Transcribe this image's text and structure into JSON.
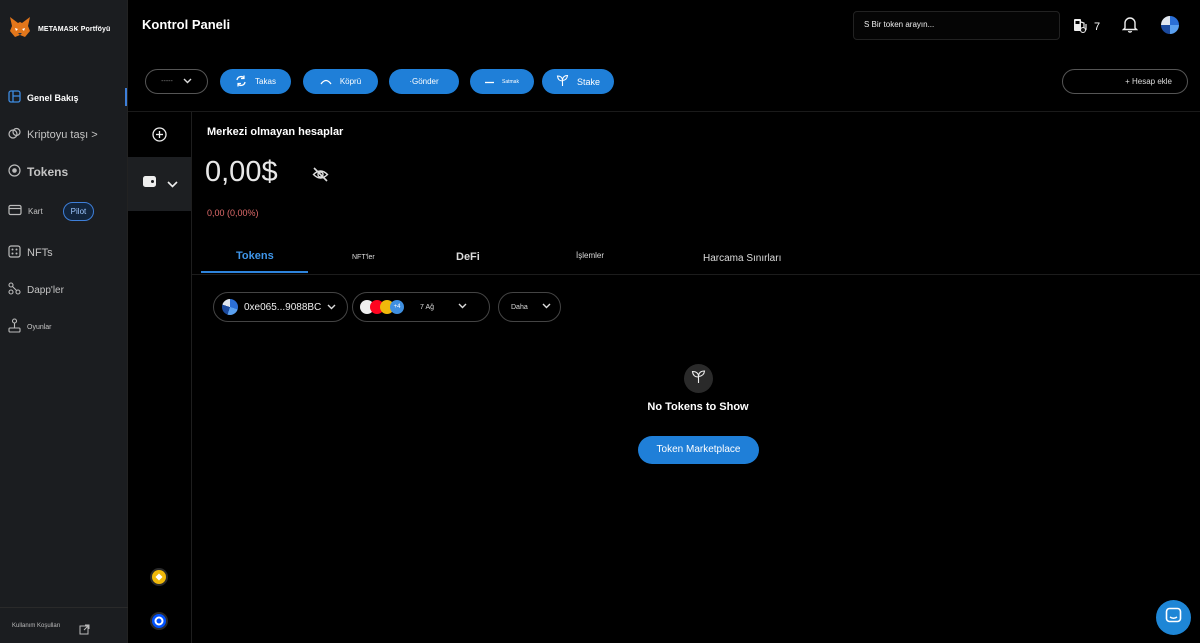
{
  "brand": {
    "name": "METAMASK Portföyü",
    "logo_icon": "fox-logo-icon"
  },
  "sidebar": {
    "items": [
      {
        "label": "Genel Bakış",
        "icon": "dashboard-icon"
      },
      {
        "label": "Kriptoyu taşı >",
        "icon": "move-icon"
      },
      {
        "label": "Tokens",
        "icon": "token-icon"
      },
      {
        "label": "Kart",
        "icon": "card-icon",
        "badge": "Pilot"
      },
      {
        "label": "NFTs",
        "icon": "grid-icon"
      },
      {
        "label": "Dapp'ler",
        "icon": "dapp-icon"
      },
      {
        "label": "Oyunlar",
        "icon": "joystick-icon"
      }
    ],
    "footer": {
      "label": "Kullanım Koşulları",
      "icon": "external-link-icon"
    }
  },
  "header": {
    "title": "Kontrol Paneli",
    "search_text": "S Bir token arayın...",
    "notifications_count": "7"
  },
  "toolbar": {
    "account_selector": "-----",
    "swap_label": "Takas",
    "bridge_label": "Köprü",
    "send_label": "·Gönder",
    "sell_label": "Satmak",
    "stake_label": "Stake",
    "add_account_label": "+ Hesap ekle"
  },
  "account": {
    "title": "Merkezi olmayan hesaplar",
    "balance": "0,00$",
    "change": "0,00 (0,00%)"
  },
  "tabs": [
    {
      "label": "Tokens",
      "active": true
    },
    {
      "label": "NFT'ler"
    },
    {
      "label": "DeFi"
    },
    {
      "label": "İşlemler"
    },
    {
      "label": "Harcama Sınırları"
    }
  ],
  "filters": {
    "address": "0xe065...9088BC",
    "networks": "7 Ağ",
    "networks_extra": "+4",
    "more": "Daha"
  },
  "empty": {
    "message": "No Tokens to Show",
    "button": "Token Marketplace"
  },
  "colors": {
    "accent": "#1f7fd8",
    "negative": "#e06b6b",
    "sidebar_bg": "#1b1d20"
  }
}
